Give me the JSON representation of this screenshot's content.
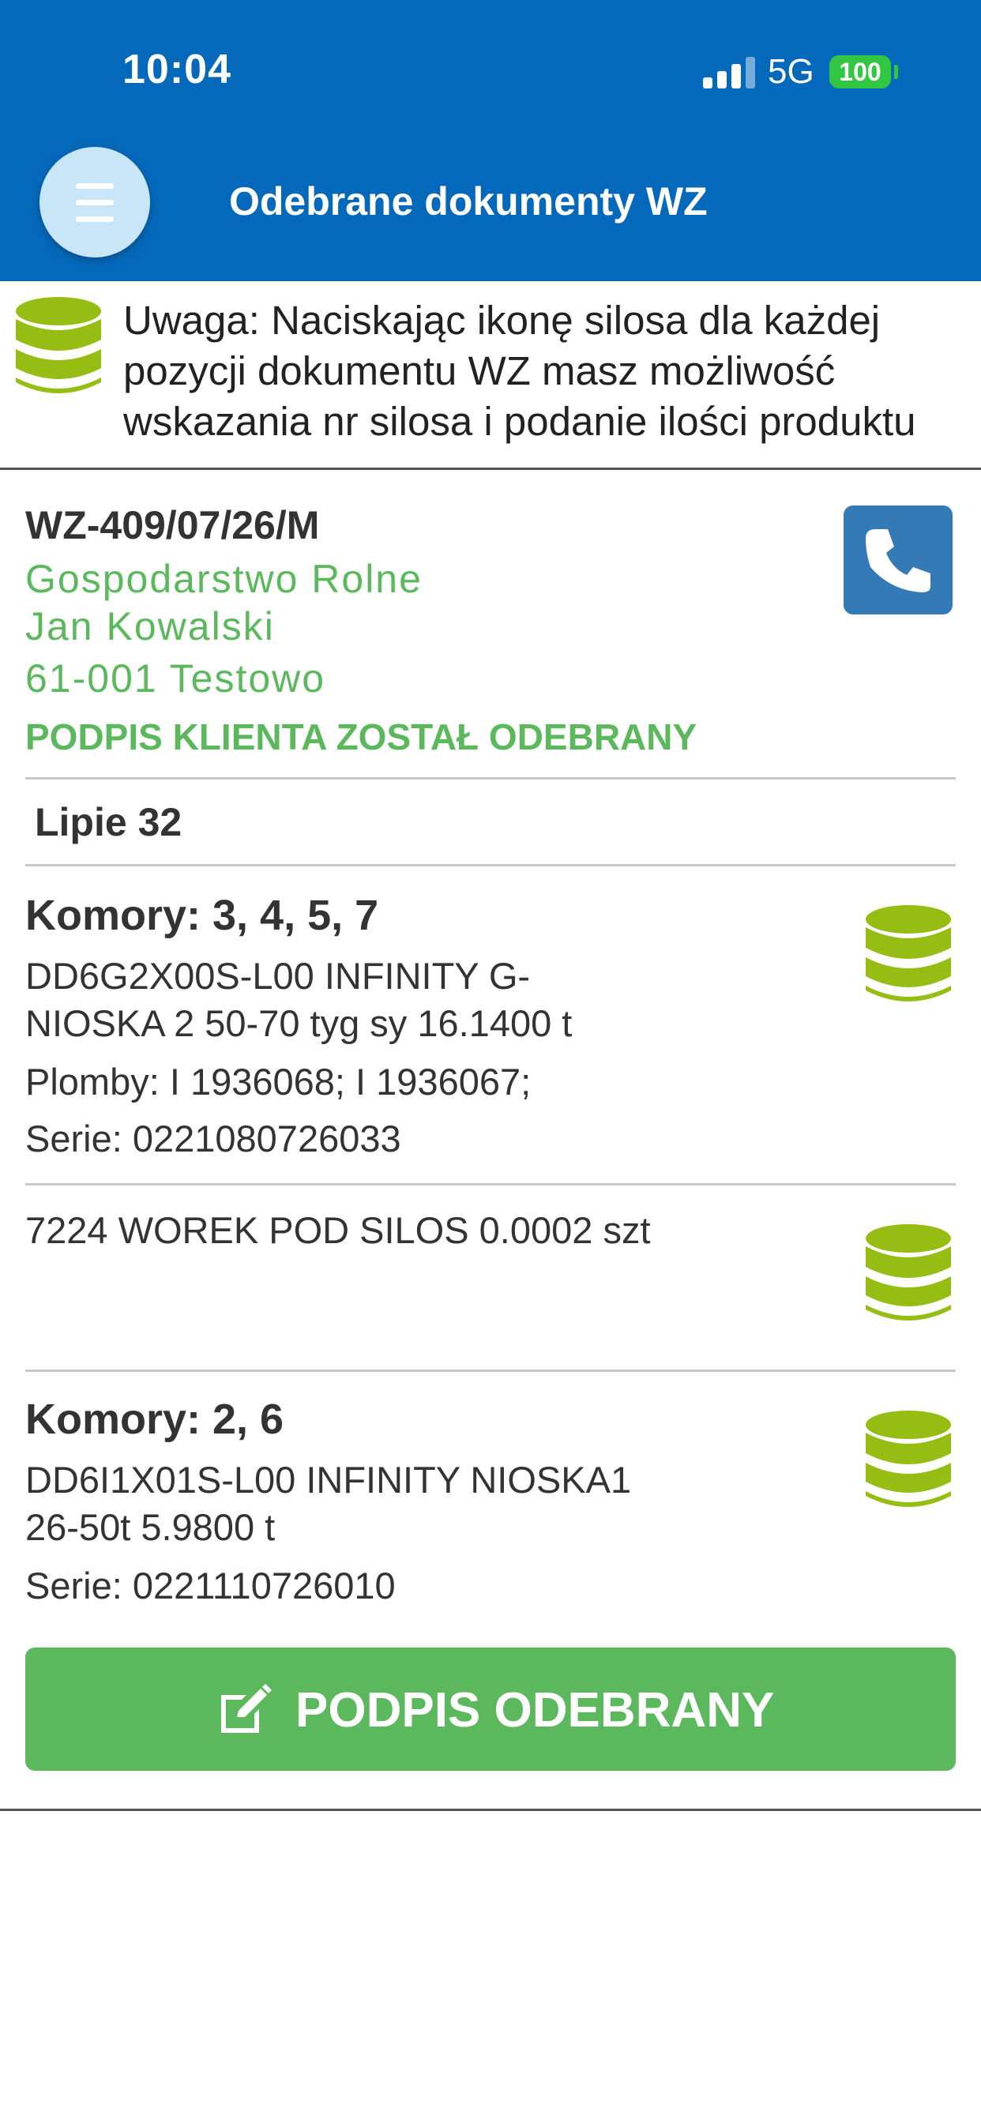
{
  "status_bar": {
    "time": "10:04",
    "network": "5G",
    "battery": "100"
  },
  "header": {
    "title": "Odebrane dokumenty WZ"
  },
  "notice": {
    "lines": [
      "Uwaga: Naciskając ikonę silosa dla każdej",
      "pozycji dokumentu WZ masz możliwość",
      "wskazania nr silosa i podanie ilości produktu"
    ]
  },
  "document": {
    "number": "WZ-409/07/26/M",
    "client": [
      "Gospodarstwo Rolne",
      "Jan Kowalski",
      "61-001 Testowo"
    ],
    "signature_status": "PODPIS KLIENTA ZOSTAŁ ODEBRANY",
    "date_label": "Lipie 32",
    "items": [
      {
        "chambers": "Komory: 3, 4, 5, 7",
        "product_lines": [
          "DD6G2X00S-L00 INFINITY G-",
          "NIOSKA 2  50-70 tyg  sy 16.1400 t"
        ],
        "seals": "Plomby: I 1936068; I 1936067;",
        "series": "Serie: 0221080726033"
      },
      {
        "chambers": "",
        "product_lines": [
          "7224 WOREK POD SILOS 0.0002 szt"
        ]
      },
      {
        "chambers": "Komory: 2, 6",
        "product_lines": [
          "DD6I1X01S-L00 INFINITY NIOSKA1",
          "26-50t 5.9800 t"
        ],
        "series": "Serie: 0221110726010"
      }
    ],
    "sign_button_label": "PODPIS ODEBRANY"
  },
  "colors": {
    "header_bg": "#0569bb",
    "accent_green": "#5cb85c",
    "silo_green": "#95bd14",
    "phone_blue": "#337ab7"
  },
  "icons": {
    "menu": "hamburger-menu-icon",
    "phone": "phone-icon",
    "silo": "database-silo-icon",
    "edit": "edit-icon"
  }
}
